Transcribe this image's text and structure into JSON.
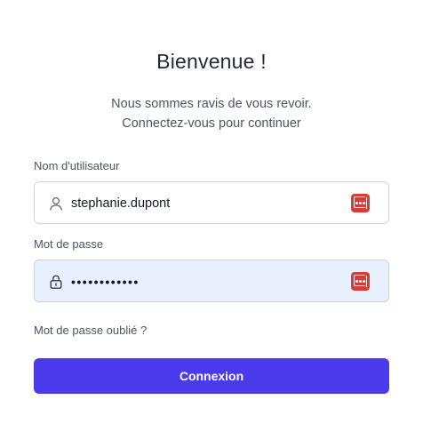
{
  "header": {
    "title": "Bienvenue !",
    "subtitle_line1": "Nous sommes ravis de vous revoir.",
    "subtitle_line2": "Connectez-vous pour continuer"
  },
  "form": {
    "username": {
      "label": "Nom d'utilisateur",
      "value": "stephanie.dupont",
      "lead_icon": "user-icon",
      "trail_icon": "password-manager-icon"
    },
    "password": {
      "label": "Mot de passe",
      "value": "••••••••••••",
      "lead_icon": "lock-icon",
      "trail_icon": "password-manager-icon"
    },
    "forgot_link": "Mot de passe oublié ?",
    "submit_label": "Connexion"
  },
  "colors": {
    "accent": "#4a3aeb",
    "password_manager": "#dc3b35",
    "autofill_bg": "#e8f0fe"
  }
}
